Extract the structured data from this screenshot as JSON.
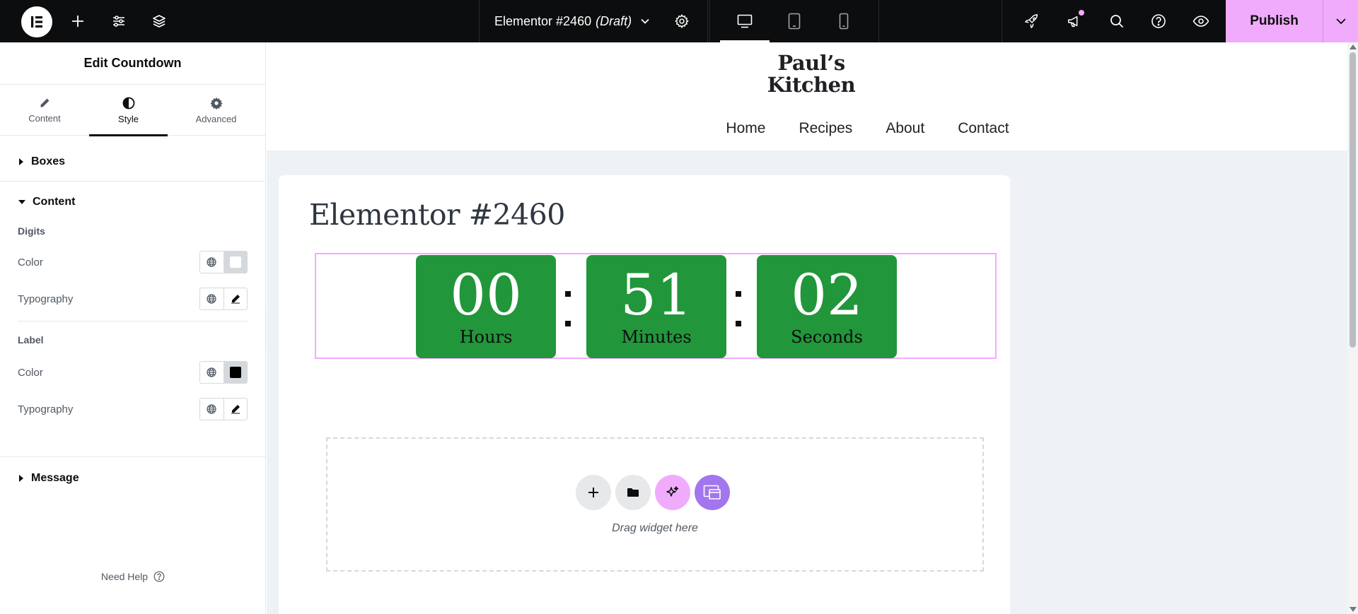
{
  "topbar": {
    "doc_title": "Elementor #2460",
    "doc_status": "(Draft)",
    "publish_label": "Publish",
    "icons": [
      "elementor-logo-icon",
      "add-icon",
      "site-settings-icon",
      "structure-icon",
      "chevron-down-icon",
      "gear-icon",
      "desktop-icon",
      "tablet-icon",
      "mobile-icon",
      "rocket-icon",
      "megaphone-icon",
      "search-icon",
      "help-icon",
      "eye-icon"
    ]
  },
  "panel": {
    "title": "Edit Countdown",
    "tabs": [
      {
        "label": "Content",
        "icon": "pencil-icon",
        "active": false
      },
      {
        "label": "Style",
        "icon": "contrast-icon",
        "active": true
      },
      {
        "label": "Advanced",
        "icon": "gear-icon",
        "active": false
      }
    ],
    "sections": {
      "boxes": "Boxes",
      "content": "Content",
      "message": "Message"
    },
    "digits": {
      "heading": "Digits",
      "color_label": "Color",
      "typography_label": "Typography",
      "color_value": "#ffffff"
    },
    "label": {
      "heading": "Label",
      "color_label": "Color",
      "typography_label": "Typography",
      "color_value": "#000000"
    },
    "need_help": "Need Help"
  },
  "site": {
    "logo_line1": "Paul’s",
    "logo_line2": "Kitchen",
    "nav": [
      "Home",
      "Recipes",
      "About",
      "Contact"
    ]
  },
  "page": {
    "title": "Elementor #2460",
    "countdown": [
      {
        "value": "00",
        "label": "Hours"
      },
      {
        "value": "51",
        "label": "Minutes"
      },
      {
        "value": "02",
        "label": "Seconds"
      }
    ],
    "dropzone_text": "Drag widget here"
  },
  "colors": {
    "accent": "#f0abfc",
    "countdown_box": "#22963a",
    "ai_button": "#f0abfc",
    "templates_button": "#a375ee"
  }
}
